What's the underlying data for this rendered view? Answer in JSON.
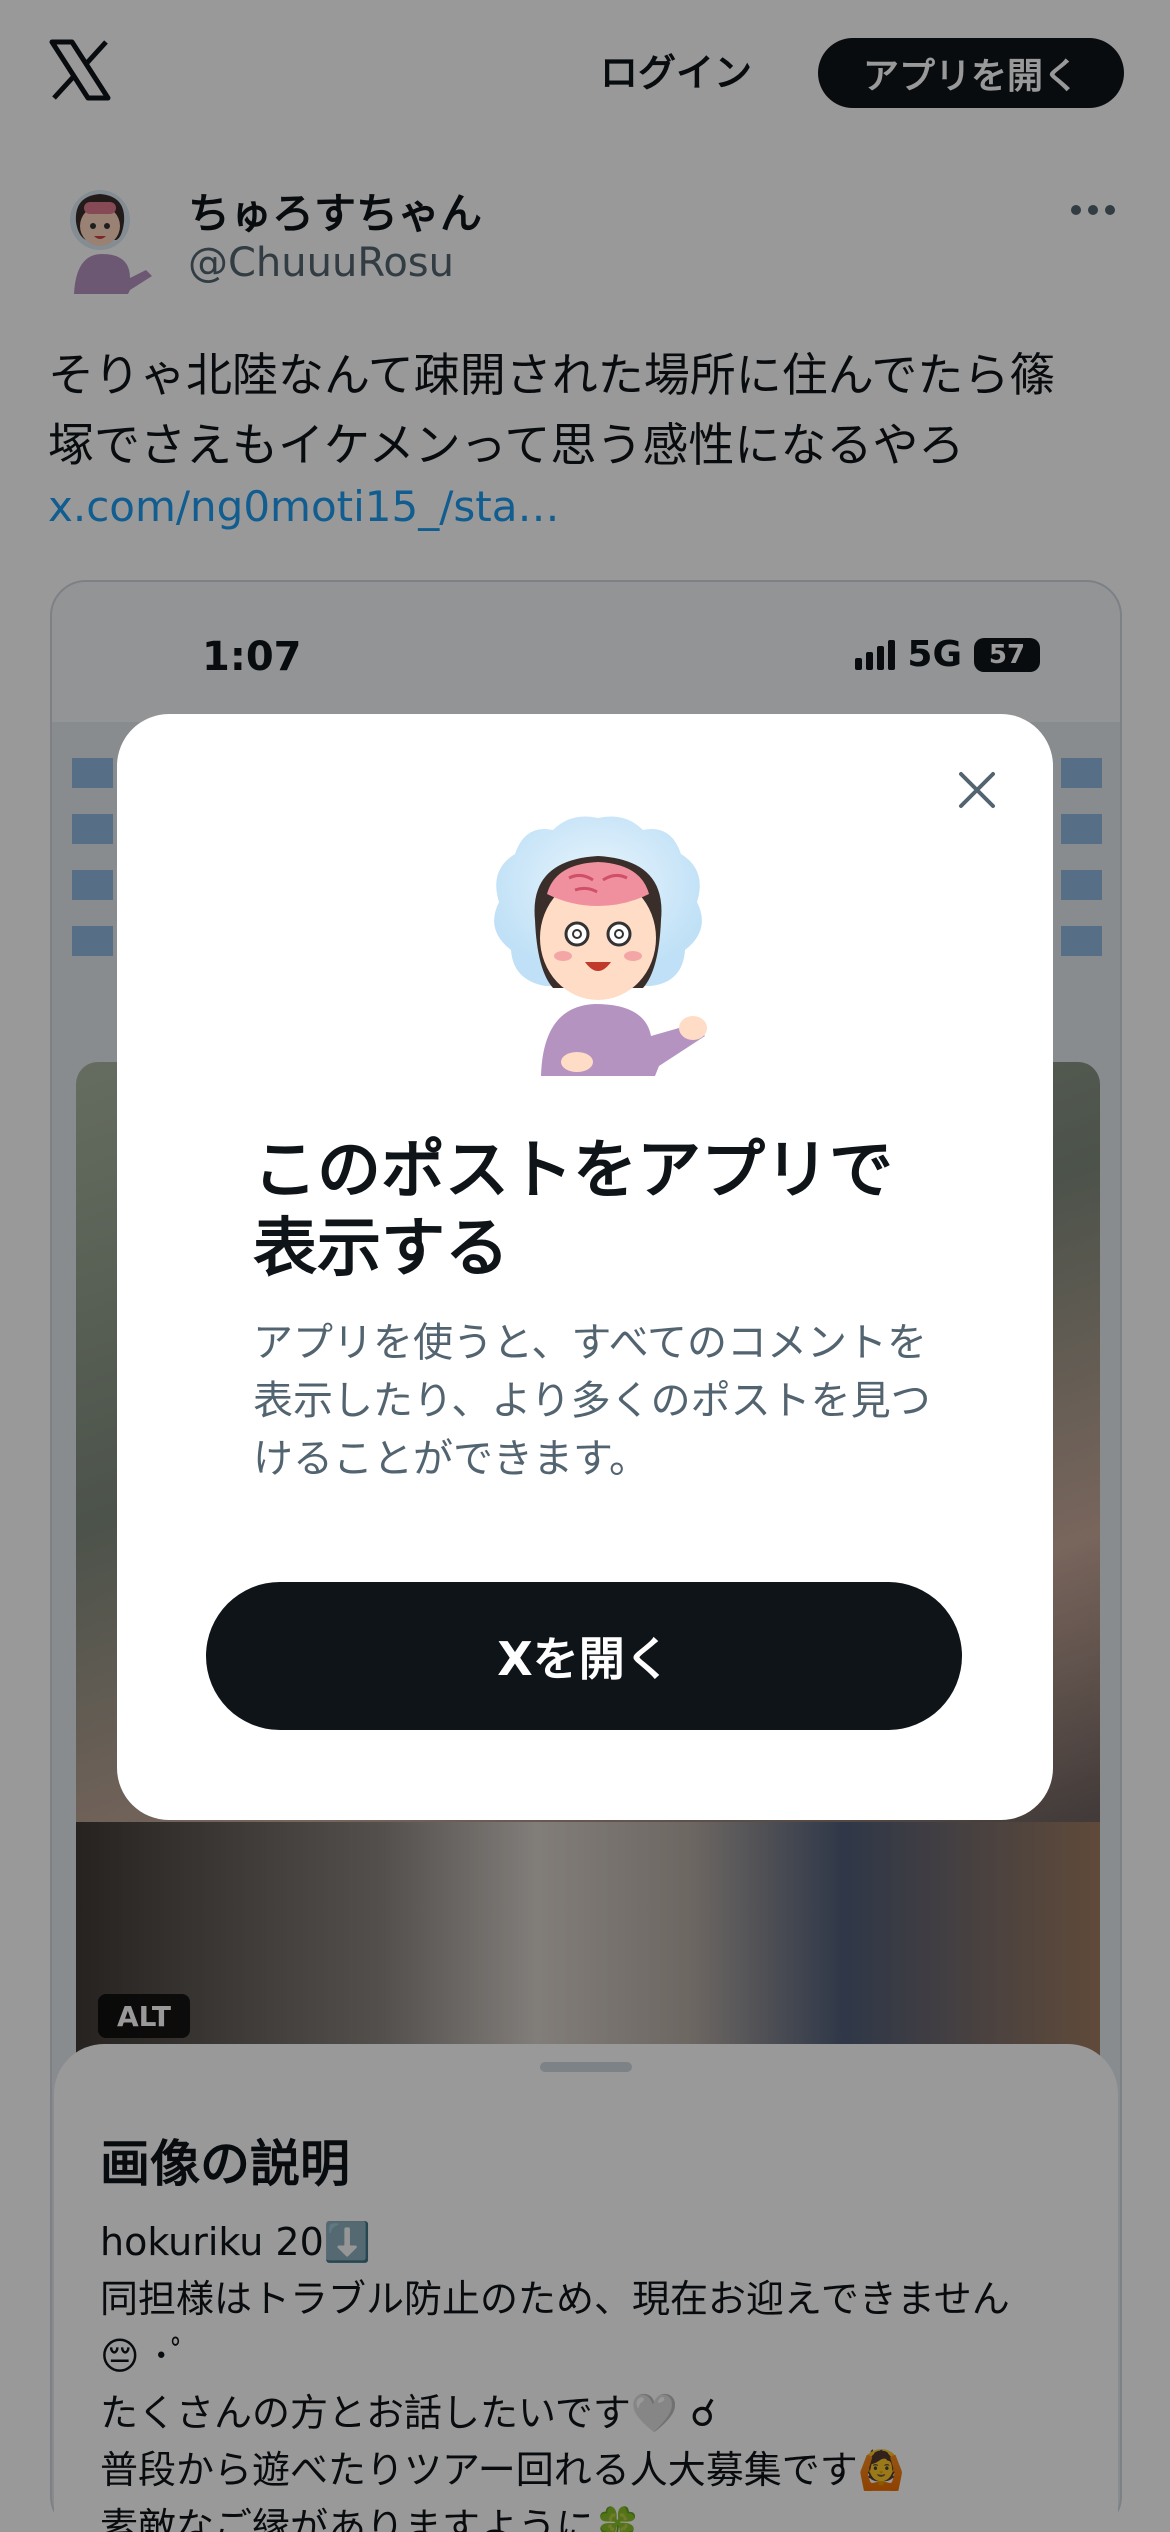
{
  "header": {
    "logo_icon": "x-logo-icon",
    "login_label": "ログイン",
    "open_app_label": "アプリを開く"
  },
  "post": {
    "author_name": "ちゅろすちゃん",
    "author_handle": "@ChuuuRosu",
    "more_icon": "more-dots-icon",
    "text_line1": "そりゃ北陸なんて疎開された場所に住んでたら篠",
    "text_line2": "塚でさえもイケメンって思う感性になるやろ",
    "link": "x.com/ng0moti15_/sta…"
  },
  "media": {
    "status_time": "1:07",
    "status_network": "5G",
    "status_battery": "57",
    "alt_badge": "ALT"
  },
  "alt_sheet": {
    "title": "画像の説明",
    "lines": [
      "hokuriku 20⬇️",
      "同担様はトラブル防止のため、現在お迎えできません",
      "😔 ･ﾟ",
      "たくさんの方とお話したいです🤍 ☌",
      "普段から遊べたりツアー回れる人大募集です🙆",
      "素敵なご縁がありますように🍀"
    ]
  },
  "modal": {
    "close_icon": "close-icon",
    "title": "このポストをアプリで表示する",
    "description": "アプリを使うと、すべてのコメントを表示したり、より多くのポストを見つけることができます。",
    "button_label": "Xを開く"
  },
  "colors": {
    "primary_dark": "#0f1419",
    "link_blue": "#1d9bf0",
    "secondary_text": "#536471",
    "overlay": "rgba(0,0,0,0.4)"
  }
}
